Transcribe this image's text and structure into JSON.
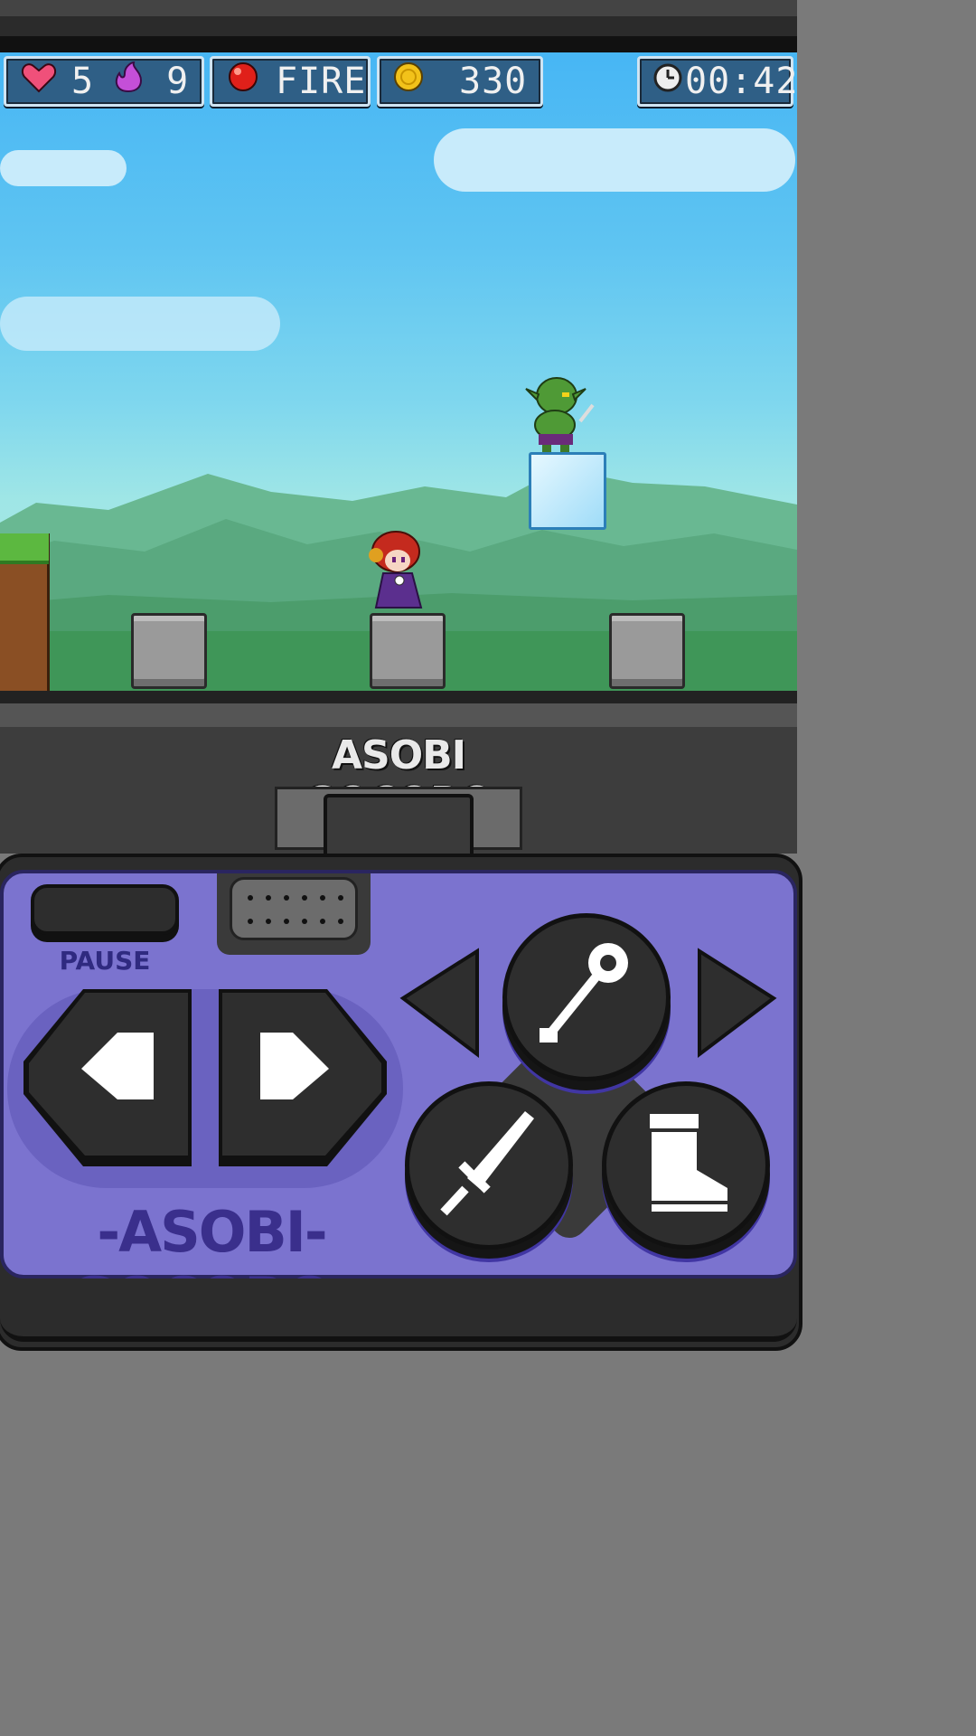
{
  "hud": {
    "lives": "5",
    "magic": "9",
    "element": "FIRE",
    "coins": "330",
    "timer": "00:42"
  },
  "console": {
    "logo_top": "ASOBI GOCORO",
    "brand_bottom": "-ASOBI-GOCORO-",
    "pause_label": "PAUSE"
  },
  "icons": {
    "heart": "heart-icon",
    "magic": "flame-icon",
    "element": "red-orb-icon",
    "coin": "coin-icon",
    "timer": "clock-icon",
    "attack": "sword-icon",
    "jump": "boot-icon",
    "item": "key-icon"
  },
  "colors": {
    "sky": "#47b6f4",
    "hud_panel": "#2f5f86",
    "panel": "#7b73cf",
    "brand": "#3a2f8c"
  }
}
